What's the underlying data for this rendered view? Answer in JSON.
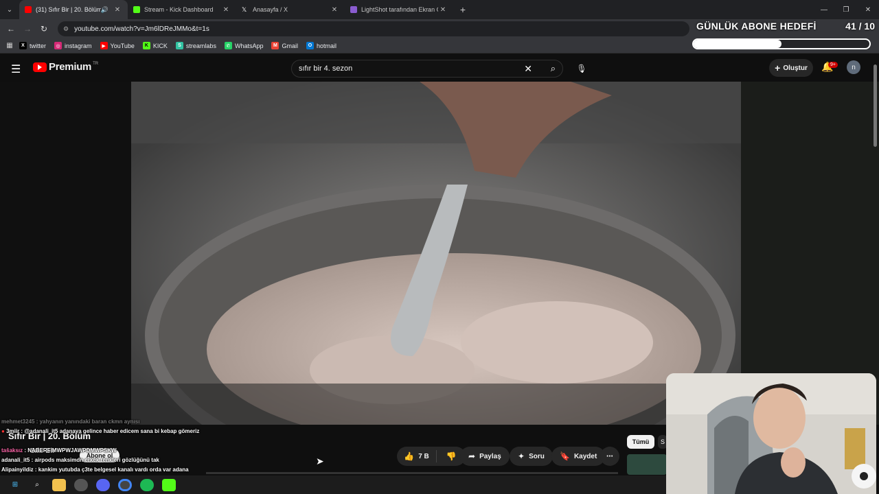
{
  "browser": {
    "tabs": [
      {
        "title": "(31) Sıfır Bir | 20. Bölüm - Yo",
        "fav_color": "#ff0000",
        "audio": "🔊",
        "active": true
      },
      {
        "title": "Stream - Kick Dashboard",
        "fav_color": "#53fc18",
        "active": false
      },
      {
        "title": "Anasayfa / X",
        "fav_color": "#000000",
        "active": false
      },
      {
        "title": "LightShot tarafından Ekran Görü",
        "fav_color": "#8a5cd0",
        "active": false
      }
    ],
    "url": "youtube.com/watch?v=Jm6lDReJMMo&t=1s",
    "bookmarks": [
      {
        "label": "twitter",
        "icon": "x-icon",
        "color": "#000000",
        "glyph": "X"
      },
      {
        "label": "instagram",
        "icon": "instagram-icon",
        "color": "#d62976",
        "glyph": "◎"
      },
      {
        "label": "YouTube",
        "icon": "youtube-icon",
        "color": "#ff0000",
        "glyph": "▶"
      },
      {
        "label": "KICK",
        "icon": "kick-icon",
        "color": "#53fc18",
        "glyph": "K"
      },
      {
        "label": "streamlabs",
        "icon": "streamlabs-icon",
        "color": "#31c3a2",
        "glyph": "S"
      },
      {
        "label": "WhatsApp",
        "icon": "whatsapp-icon",
        "color": "#25d366",
        "glyph": "✆"
      },
      {
        "label": "Gmail",
        "icon": "gmail-icon",
        "color": "#ea4335",
        "glyph": "M"
      },
      {
        "label": "hotmail",
        "icon": "outlook-icon",
        "color": "#0078d4",
        "glyph": "O"
      }
    ]
  },
  "overlay": {
    "goal_title": "GÜNLÜK ABONE HEDEFİ",
    "goal_count": "41 / 10",
    "goal_progress": 0.5
  },
  "youtube": {
    "logo_text": "Premium",
    "logo_region": "TR",
    "search_value": "sıfır bir 4. sezon",
    "create_label": "Oluştur",
    "notif_badge": "9+",
    "avatar_letter": "n",
    "video_title": "Sıfır Bir | 20. Bölüm",
    "channel_name": "Sıfır Bir",
    "subscribe_label": "Abone ol",
    "like_count": "7 B",
    "share_label": "Paylaş",
    "ask_label": "Soru",
    "save_label": "Kaydet",
    "chip_all": "Tümü",
    "chip_next": "S"
  },
  "chat": [
    {
      "user": "mehmet3245",
      "text": " : yahyanın yanındaki baran ckmn aynısı",
      "faded": true
    },
    {
      "user": "3miir",
      "text": " : @adanali_it5 adanaya gelince haber edicem sana bi kebap gömeriz",
      "faded": false
    },
    {
      "user": "tašaksız",
      "text": " : NABERFIMWPWJAWPDMWPSKW",
      "faded": false
    },
    {
      "user": "adanali_it5",
      "text": " : airpods maksimdn erkek renkleri gözlüğünü tak",
      "faded": false
    },
    {
      "user": "Alipainyildiz",
      "text": " : kankim yutubda ç3te belgesel kanalı vardı orda var adana videosuna bak",
      "faded": false
    }
  ],
  "colors": {
    "yt_red": "#ff0000",
    "bg": "#0f0f0f",
    "pill": "#272727"
  }
}
